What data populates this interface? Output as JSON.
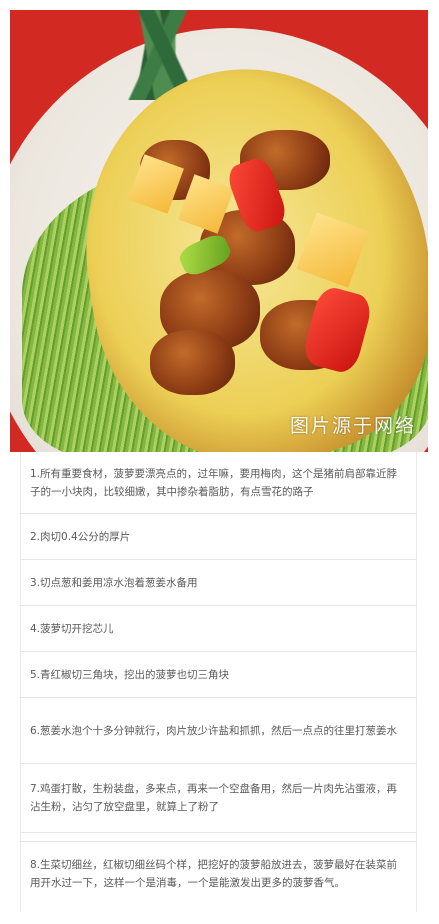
{
  "hero": {
    "image_label": "pineapple-sweet-and-sour-pork-photo",
    "watermark": "图片源于网络"
  },
  "steps": [
    {
      "text": "1.所有重要食材，菠萝要漂亮点的，过年嘛，要用梅肉，这个是猪前肩部靠近脖子的一小块肉，比较细嫩，其中掺杂着脂肪，有点雪花的路子"
    },
    {
      "text": "2.肉切0.4公分的厚片"
    },
    {
      "text": "3.切点葱和姜用凉水泡着葱姜水备用"
    },
    {
      "text": "4.菠萝切开挖芯儿"
    },
    {
      "text": "5.青红椒切三角块，挖出的菠萝也切三角块"
    },
    {
      "text": "6.葱姜水泡个十多分钟就行，肉片放少许盐和抓抓，然后一点点的往里打葱姜水"
    },
    {
      "text": "7.鸡蛋打散，生粉装盘，多来点，再来一个空盘备用，然后一片肉先沾蛋液，再沾生粉，沾匀了放空盘里，就算上了粉了"
    },
    {
      "text": "8.生菜切细丝，红椒切细丝码个样，把挖好的菠萝船放进去，菠萝最好在装菜前用开水过一下，这样一个是消毒，一个是能激发出更多的菠萝香气。"
    }
  ],
  "colors": {
    "text": "#5a5a5a",
    "divider": "#e6e6e6",
    "background": "#ffffff"
  }
}
